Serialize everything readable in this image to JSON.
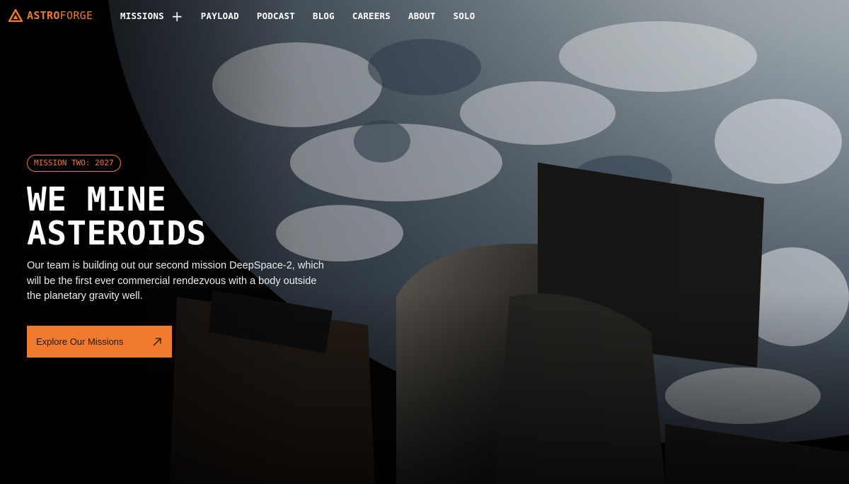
{
  "brand": {
    "name_part1": "ASTRO",
    "name_part2": "FORGE",
    "accent": "#f07b2e",
    "logo_icon": "astroforge-logo-icon"
  },
  "nav": {
    "missions": "MISSIONS",
    "missions_expand_icon": "plus-icon",
    "payload": "PAYLOAD",
    "podcast": "PODCAST",
    "blog": "BLOG",
    "careers": "CAREERS",
    "about": "ABOUT",
    "solo": "SOLO"
  },
  "hero": {
    "badge": "MISSION TWO: 2027",
    "headline_line1": "WE MINE",
    "headline_line2": "ASTEROIDS",
    "subtext": "Our team is building out our second mission DeepSpace-2, which will be the first ever commercial rendezvous with a body outside the planetary gravity well.",
    "cta_label": "Explore Our Missions",
    "cta_icon": "arrow-up-right-icon",
    "background_image": "earth-from-space-station"
  }
}
